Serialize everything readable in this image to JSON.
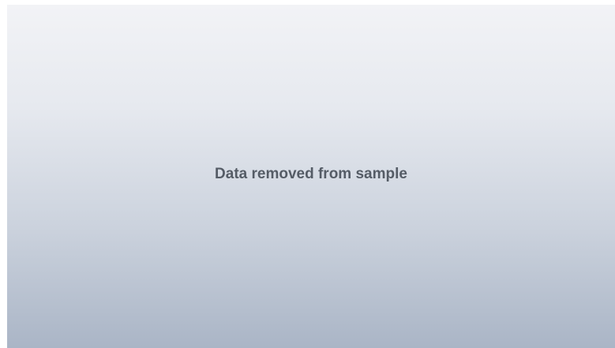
{
  "placeholder": {
    "message": "Data removed from sample"
  },
  "colors": {
    "gradient_top": "#f2f3f6",
    "gradient_bottom": "#aab5c6",
    "text": "#555c66"
  }
}
